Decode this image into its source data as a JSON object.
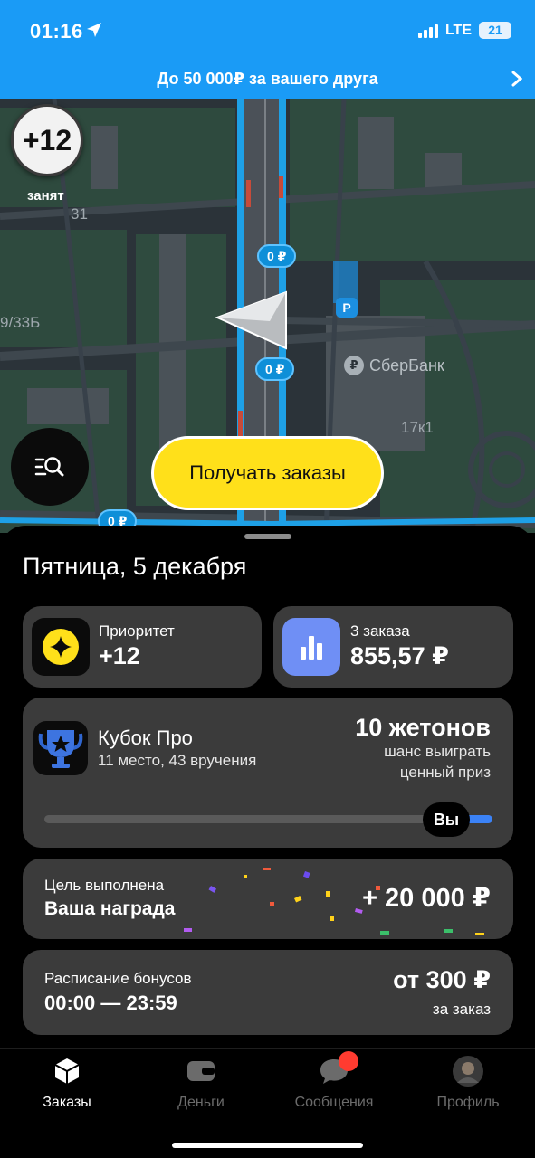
{
  "status_bar": {
    "time": "01:16",
    "network": "LTE",
    "battery": "21"
  },
  "promo": {
    "text": "До 50 000₽ за вашего друга"
  },
  "map": {
    "labels": {
      "house_31": "31",
      "house_9_33b": "9/33Б",
      "house_17k1": "17к1"
    },
    "price_pins": [
      "0 ₽",
      "0 ₽",
      "0 ₽"
    ],
    "parking": "P",
    "poi": {
      "icon": "₽",
      "name": "СберБанк"
    }
  },
  "priority_badge": {
    "value": "+12",
    "status": "занят"
  },
  "get_orders_button": "Получать заказы",
  "sheet": {
    "date": "Пятница, 5 декабря",
    "priority_card": {
      "label": "Приоритет",
      "value": "+12"
    },
    "orders_card": {
      "label": "3 заказа",
      "value": "855,57 ₽"
    },
    "cup_card": {
      "title": "Кубок Про",
      "subtitle": "11 место, 43 вручения",
      "tokens": "10 жетонов",
      "hint_line1": "шанс выиграть",
      "hint_line2": "ценный приз",
      "you_label": "Вы",
      "progress": 0.1
    },
    "goal_card": {
      "label": "Цель выполнена",
      "title": "Ваша награда",
      "amount": "+ 20 000 ₽"
    },
    "bonus_card": {
      "label": "Расписание бонусов",
      "time": "00:00 — 23:59",
      "amount": "от 300 ₽",
      "unit": "за заказ"
    }
  },
  "tabs": [
    {
      "label": "Заказы",
      "icon": "box-icon",
      "active": true
    },
    {
      "label": "Деньги",
      "icon": "wallet-icon",
      "active": false
    },
    {
      "label": "Сообщения",
      "icon": "chat-bubble-icon",
      "active": false
    },
    {
      "label": "Профиль",
      "icon": "avatar",
      "active": false
    }
  ],
  "colors": {
    "accent_blue": "#1a9bf6",
    "yellow": "#ffe01a",
    "card": "#3b3b3b",
    "progress": "#3b82f6",
    "badge_red": "#ff3b30"
  }
}
